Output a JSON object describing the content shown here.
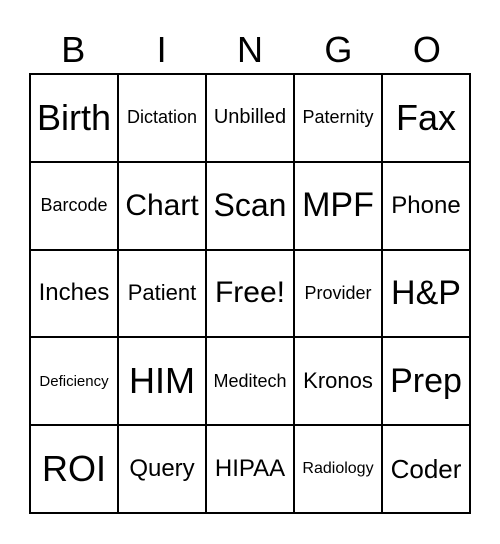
{
  "header": [
    "B",
    "I",
    "N",
    "G",
    "O"
  ],
  "cells": [
    "Birth",
    "Dictation",
    "Unbilled",
    "Paternity",
    "Fax",
    "Barcode",
    "Chart",
    "Scan",
    "MPF",
    "Phone",
    "Inches",
    "Patient",
    "Free!",
    "Provider",
    "H&P",
    "Deficiency",
    "HIM",
    "Meditech",
    "Kronos",
    "Prep",
    "ROI",
    "Query",
    "HIPAA",
    "Radiology",
    "Coder"
  ]
}
